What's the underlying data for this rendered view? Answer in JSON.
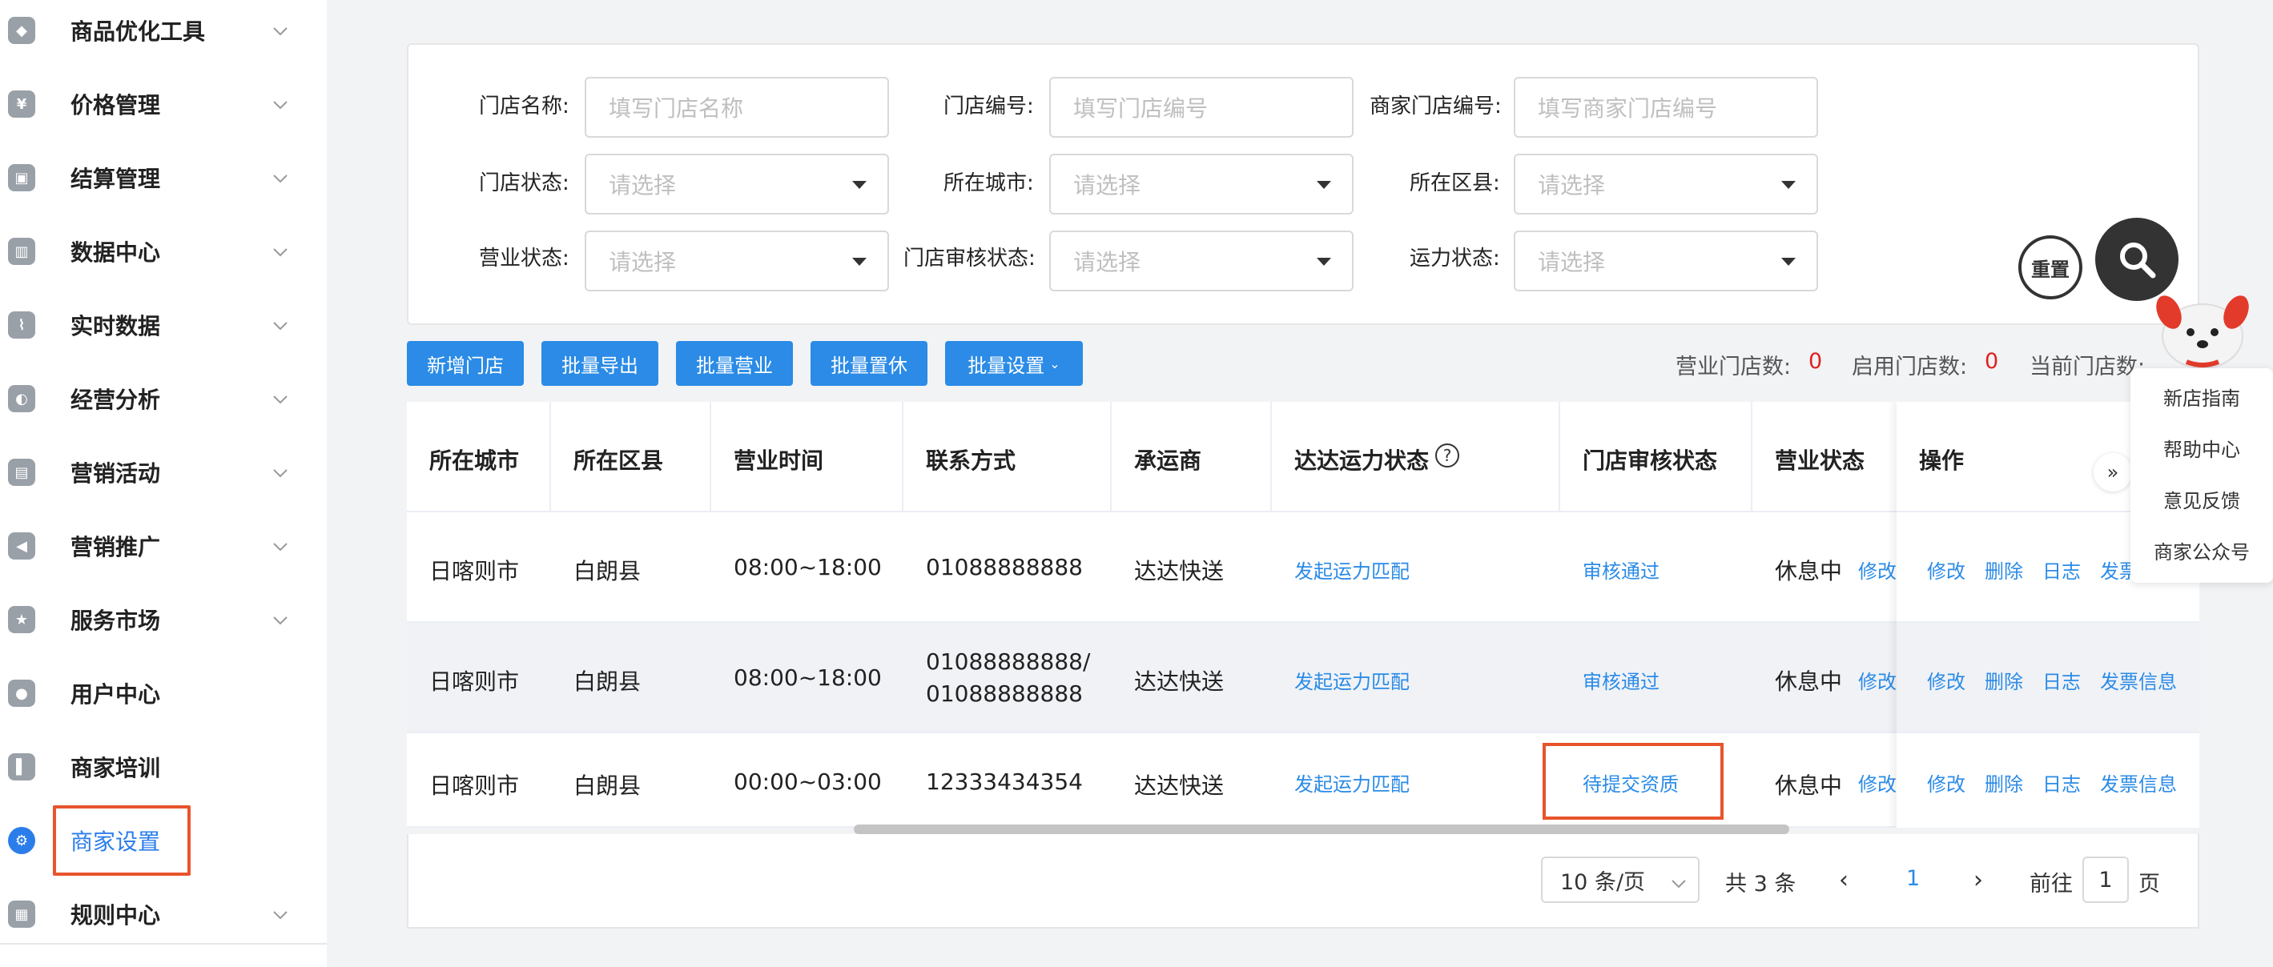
{
  "sidebar": {
    "items": [
      {
        "label": "商品优化工具",
        "icon": "cube-icon"
      },
      {
        "label": "价格管理",
        "icon": "price-icon"
      },
      {
        "label": "结算管理",
        "icon": "wallet-icon"
      },
      {
        "label": "数据中心",
        "icon": "data-icon"
      },
      {
        "label": "实时数据",
        "icon": "chart-line-icon"
      },
      {
        "label": "经营分析",
        "icon": "pie-icon"
      },
      {
        "label": "营销活动",
        "icon": "gift-icon"
      },
      {
        "label": "营销推广",
        "icon": "megaphone-icon"
      },
      {
        "label": "服务市场",
        "icon": "star-icon"
      },
      {
        "label": "用户中心",
        "icon": "user-icon"
      },
      {
        "label": "商家培训",
        "icon": "book-icon"
      },
      {
        "label": "商家设置",
        "icon": "gear-icon"
      },
      {
        "label": "规则中心",
        "icon": "rules-icon"
      }
    ]
  },
  "filters": {
    "store_name_label": "门店名称:",
    "store_name_placeholder": "填写门店名称",
    "store_no_label": "门店编号:",
    "store_no_placeholder": "填写门店编号",
    "merchant_store_no_label": "商家门店编号:",
    "merchant_store_no_placeholder": "填写商家门店编号",
    "store_status_label": "门店状态:",
    "city_label": "所在城市:",
    "district_label": "所在区县:",
    "business_status_label": "营业状态:",
    "audit_status_label": "门店审核状态:",
    "capacity_status_label": "运力状态:",
    "select_placeholder": "请选择",
    "reset_label": "重置"
  },
  "toolbar": {
    "add_store": "新增门店",
    "batch_export": "批量导出",
    "batch_open": "批量营业",
    "batch_rest": "批量置休",
    "batch_settings": "批量设置"
  },
  "stats": {
    "open_label": "营业门店数:",
    "open_value": "0",
    "enabled_label": "启用门店数:",
    "enabled_value": "0",
    "current_label": "当前门店数:"
  },
  "help_menu": [
    "新店指南",
    "帮助中心",
    "意见反馈",
    "商家公众号"
  ],
  "table": {
    "headers": [
      "所在城市",
      "所在区县",
      "营业时间",
      "联系方式",
      "承运商",
      "达达运力状态",
      "门店审核状态",
      "营业状态",
      "操作"
    ],
    "rows": [
      {
        "city": "日喀则市",
        "district": "白朗县",
        "hours": "08:00~18:00",
        "phone": "01088888888",
        "phone2": "",
        "carrier": "达达快送",
        "capacity": "发起运力匹配",
        "audit": "审核通过",
        "status": "休息中",
        "status_link": "修改",
        "ops": [
          "修改",
          "删除",
          "日志",
          "发票"
        ]
      },
      {
        "city": "日喀则市",
        "district": "白朗县",
        "hours": "08:00~18:00",
        "phone": "01088888888/",
        "phone2": "01088888888",
        "carrier": "达达快送",
        "capacity": "发起运力匹配",
        "audit": "审核通过",
        "status": "休息中",
        "status_link": "修改",
        "ops": [
          "修改",
          "删除",
          "日志",
          "发票信息"
        ]
      },
      {
        "city": "日喀则市",
        "district": "白朗县",
        "hours": "00:00~03:00",
        "phone": "12333434354",
        "phone2": "",
        "carrier": "达达快送",
        "capacity": "发起运力匹配",
        "audit": "待提交资质",
        "status": "休息中",
        "status_link": "修改",
        "ops": [
          "修改",
          "删除",
          "日志",
          "发票信息"
        ]
      }
    ]
  },
  "pagination": {
    "page_size": "10 条/页",
    "total": "共 3 条",
    "current": "1",
    "goto_label": "前往",
    "goto_value": "1",
    "page_suffix": "页"
  }
}
